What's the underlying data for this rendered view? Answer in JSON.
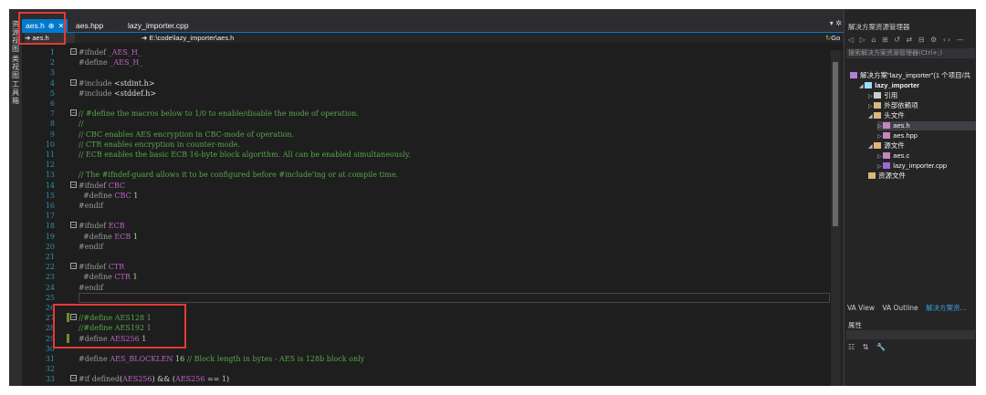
{
  "left_toolbar": {
    "items": [
      "资源视图",
      "类视图",
      "工具箱"
    ]
  },
  "tabs": [
    {
      "label": "aes.h",
      "pin": "⊕",
      "close": "✕",
      "active": true
    },
    {
      "label": "aes.hpp",
      "active": false
    },
    {
      "label": "lazy_importer.cpp",
      "active": false
    }
  ],
  "tab_menu": "▾ ✲",
  "navbar": {
    "scope": "aes.h",
    "path": "E:\\code\\lazy_importer\\aes.h",
    "go": "Go"
  },
  "code_lines": [
    {
      "n": "1",
      "fold": "⊟",
      "html": "<span class='tk-pp'>#ifndef</span> <span class='tk-mac'>_AES_H_</span>"
    },
    {
      "n": "2",
      "html": "<span class='tk-pp'>#define</span> <span class='tk-mac'>_AES_H_</span>"
    },
    {
      "n": "3",
      "html": ""
    },
    {
      "n": "4",
      "fold": "⊟",
      "html": "<span class='tk-pp'>#include</span> &lt;stdint.h&gt;"
    },
    {
      "n": "5",
      "html": "<span class='tk-pp'>#include</span> &lt;stddef.h&gt;"
    },
    {
      "n": "6",
      "html": ""
    },
    {
      "n": "7",
      "fold": "⊟",
      "html": "<span class='tk-com'>// #define the macros below to 1/0 to enable/disable the mode of operation.</span>"
    },
    {
      "n": "8",
      "html": "<span class='tk-com'>//</span>"
    },
    {
      "n": "9",
      "html": "<span class='tk-com'>// CBC enables AES encryption in CBC-mode of operation.</span>"
    },
    {
      "n": "10",
      "html": "<span class='tk-com'>// CTR enables encryption in counter-mode.</span>"
    },
    {
      "n": "11",
      "html": "<span class='tk-com'>// ECB enables the basic ECB 16-byte block algorithm. All can be enabled simultaneously.</span>"
    },
    {
      "n": "12",
      "html": ""
    },
    {
      "n": "13",
      "html": "<span class='tk-com'>// The #ifndef-guard allows it to be configured before #include'ing or at compile time.</span>"
    },
    {
      "n": "14",
      "fold": "⊟",
      "html": "<span class='tk-pp'>#ifndef</span> <span class='tk-mac'>CBC</span>"
    },
    {
      "n": "15",
      "html": "  <span class='tk-pp'>#define</span> <span class='tk-mac'>CBC</span> <span class='tk-num'>1</span>"
    },
    {
      "n": "16",
      "html": "<span class='tk-pp'>#endif</span>"
    },
    {
      "n": "17",
      "html": ""
    },
    {
      "n": "18",
      "fold": "⊟",
      "html": "<span class='tk-pp'>#ifndef</span> <span class='tk-mac'>ECB</span>"
    },
    {
      "n": "19",
      "html": "  <span class='tk-pp'>#define</span> <span class='tk-mac'>ECB</span> <span class='tk-num'>1</span>"
    },
    {
      "n": "20",
      "html": "<span class='tk-pp'>#endif</span>"
    },
    {
      "n": "21",
      "html": ""
    },
    {
      "n": "22",
      "fold": "⊟",
      "html": "<span class='tk-pp'>#ifndef</span> <span class='tk-mac'>CTR</span>"
    },
    {
      "n": "23",
      "html": "  <span class='tk-pp'>#define</span> <span class='tk-mac'>CTR</span> <span class='tk-num'>1</span>"
    },
    {
      "n": "24",
      "html": "<span class='tk-pp'>#endif</span>"
    },
    {
      "n": "25",
      "html": "",
      "current": true
    },
    {
      "n": "26",
      "html": ""
    },
    {
      "n": "27",
      "fold": "⊟",
      "changed": true,
      "html": "<span class='tk-com'>//#define AES128 1</span>"
    },
    {
      "n": "28",
      "html": "<span class='tk-com'>//#define AES192 1</span>"
    },
    {
      "n": "29",
      "changed": true,
      "html": "<span class='tk-pp'>#define</span> <span class='tk-mac'>AES256</span> <span class='tk-num'>1</span>"
    },
    {
      "n": "30",
      "html": ""
    },
    {
      "n": "31",
      "html": "<span class='tk-pp'>#define</span> <span class='tk-mac'>AES_BLOCKLEN</span> <span class='tk-num'>16</span> <span class='tk-com'>// Block length in bytes - AES is 128b block only</span>"
    },
    {
      "n": "32",
      "html": ""
    },
    {
      "n": "33",
      "fold": "⊟",
      "html": "<span class='tk-pp'>#if</span> <span class='tk-pp'>defined</span>(<span class='tk-mac'>AES256</span>) &amp;&amp; (<span class='tk-mac'>AES256</span> == <span class='tk-num'>1</span>)"
    }
  ],
  "solution": {
    "title": "解决方案资源管理器",
    "toolbar": "◁ ▷ ⌂ ⊞ ↺ ⇄ ⊟ ⚙ ‹› —",
    "search_placeholder": "搜索解决方案资源管理器(Ctrl+;)",
    "nodes": [
      {
        "label": "解决方案\"lazy_importer\"(1 个项目/共",
        "indent": 0,
        "arrow": "",
        "icon": "#b180d7"
      },
      {
        "label": "lazy_importer",
        "indent": 1,
        "arrow": "◢",
        "icon": "#9cdcfe",
        "bold": true
      },
      {
        "label": "引用",
        "indent": 2,
        "arrow": "▷",
        "icon": "#cccccc"
      },
      {
        "label": "外部依赖项",
        "indent": 2,
        "arrow": "▷",
        "icon": "#dcb67a"
      },
      {
        "label": "头文件",
        "indent": 2,
        "arrow": "◢",
        "icon": "#dcb67a"
      },
      {
        "label": "aes.h",
        "indent": 3,
        "arrow": "▷",
        "icon": "#c586c0",
        "selected": true
      },
      {
        "label": "aes.hpp",
        "indent": 3,
        "arrow": "▷",
        "icon": "#c586c0"
      },
      {
        "label": "源文件",
        "indent": 2,
        "arrow": "◢",
        "icon": "#dcb67a"
      },
      {
        "label": "aes.c",
        "indent": 3,
        "arrow": "▷",
        "icon": "#c586c0"
      },
      {
        "label": "lazy_importer.cpp",
        "indent": 3,
        "arrow": "▷",
        "icon": "#9b6bd3"
      },
      {
        "label": "资源文件",
        "indent": 2,
        "arrow": "",
        "icon": "#dcb67a"
      }
    ],
    "bottom_tabs": [
      "VA View",
      "VA Outline",
      "解决方案资..."
    ],
    "properties_title": "属性",
    "properties_tools": "☷ ⇅ 🔧"
  }
}
